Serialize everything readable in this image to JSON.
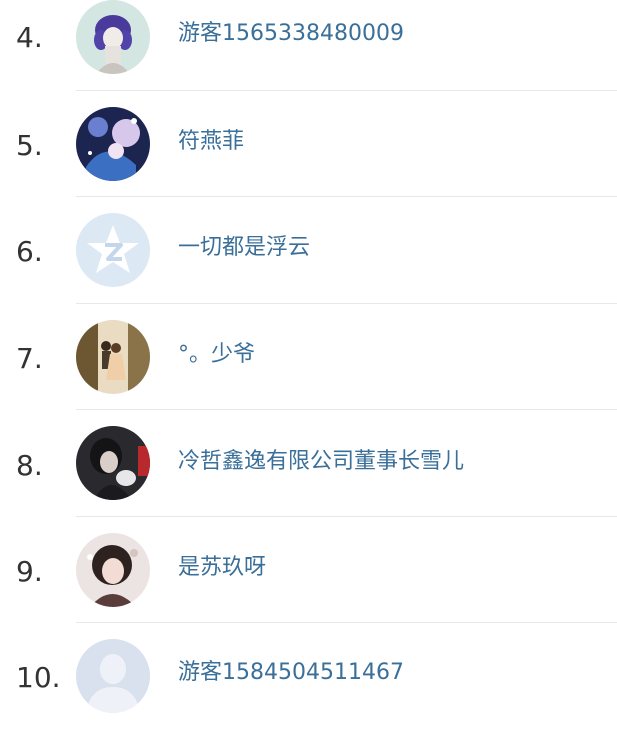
{
  "ranking": {
    "items": [
      {
        "rank": "4.",
        "name": "游客1565338480009",
        "avatar": "anime-girl-purple-hair-avatar"
      },
      {
        "rank": "5.",
        "name": "符燕菲",
        "avatar": "fantasy-illustration-avatar"
      },
      {
        "rank": "6.",
        "name": "一切都是浮云",
        "avatar": "default-qzone-star-avatar"
      },
      {
        "rank": "7.",
        "name": "°。少爷",
        "avatar": "couple-photo-avatar"
      },
      {
        "rank": "8.",
        "name": "冷哲鑫逸有限公司董事长雪儿",
        "avatar": "dark-portrait-avatar"
      },
      {
        "rank": "9.",
        "name": "是苏玖呀",
        "avatar": "girl-selfie-avatar"
      },
      {
        "rank": "10.",
        "name": "游客1584504511467",
        "avatar": "default-person-silhouette-avatar"
      }
    ]
  },
  "colors": {
    "name_link": "#3a6f99",
    "rank_text": "#333333",
    "divider": "#e8e8e8"
  }
}
